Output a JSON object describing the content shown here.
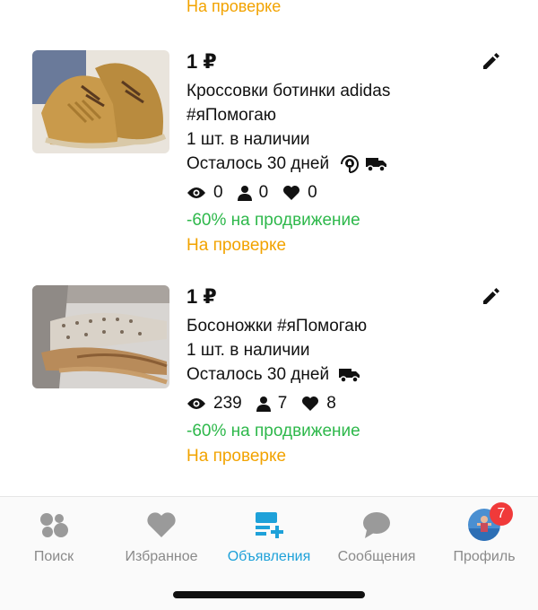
{
  "top_status": "На проверке",
  "listings": [
    {
      "price": "1 ₽",
      "title_line1": "Кроссовки ботинки adidas",
      "title_line2": "#яПомогаю",
      "stock": "1 шт. в наличии",
      "days_left": "Осталось 30 дней",
      "views": "0",
      "contacts": "0",
      "likes": "0",
      "promo": "-60% на продвижение",
      "status": "На проверке"
    },
    {
      "price": "1 ₽",
      "title_line1": "Босоножки #яПомогаю",
      "stock": "1 шт. в наличии",
      "days_left": "Осталось 30 дней",
      "views": "239",
      "contacts": "7",
      "likes": "8",
      "promo": "-60% на продвижение",
      "status": "На проверке"
    }
  ],
  "tabbar": {
    "tabs": [
      {
        "label": "Поиск",
        "icon": "search-dots-icon"
      },
      {
        "label": "Избранное",
        "icon": "heart-icon"
      },
      {
        "label": "Объявления",
        "icon": "listings-icon"
      },
      {
        "label": "Сообщения",
        "icon": "chat-icon"
      },
      {
        "label": "Профиль",
        "icon": "avatar"
      }
    ],
    "active": "Объявления",
    "profile_badge": "7"
  },
  "colors": {
    "accent": "#1ea1d9",
    "promo": "#2eb84b",
    "status": "#f2a300",
    "badge": "#f03a3a"
  }
}
